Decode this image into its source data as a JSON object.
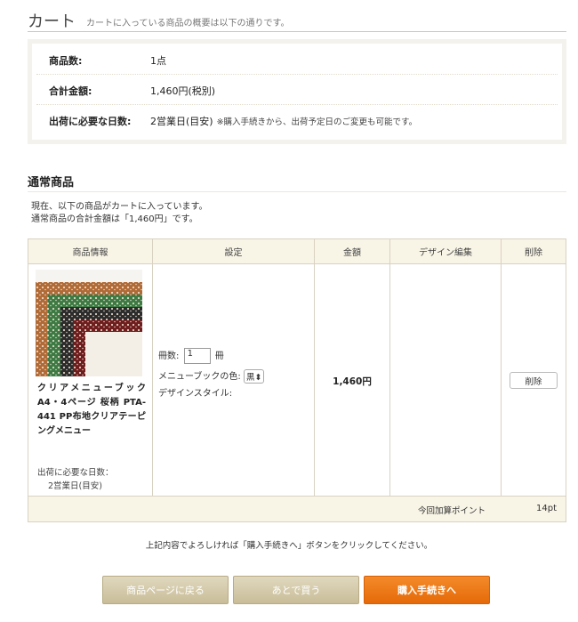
{
  "header": {
    "title": "カート",
    "subtitle": "カートに入っている商品の概要は以下の通りです。"
  },
  "summary": {
    "items_label": "商品数:",
    "items_value": "1点",
    "total_label": "合計金額:",
    "total_value": "1,460円(税別)",
    "ship_label": "出荷に必要な日数:",
    "ship_value": "2営業日(目安)",
    "ship_note": "※購入手続きから、出荷予定日のご変更も可能です。"
  },
  "section": {
    "title": "通常商品",
    "intro_line1": "現在、以下の商品がカートに入っています。",
    "intro_line2": "通常商品の合計金額は「1,460円」です。"
  },
  "table": {
    "headers": [
      "商品情報",
      "設定",
      "金額",
      "デザイン編集",
      "削除"
    ],
    "item": {
      "name": "クリアメニューブック A4・4ページ 桜柄 PTA-441 PP布地クリアテーピングメニュー",
      "ship_label": "出荷に必要な日数：",
      "ship_value": "2営業日(目安)",
      "qty_label": "冊数:",
      "qty_value": "1",
      "qty_unit": "冊",
      "color_label": "メニューブックの色:",
      "color_value": "黒",
      "style_label": "デザインスタイル:",
      "price": "1,460円",
      "delete_label": "削除"
    },
    "points_label": "今回加算ポイント",
    "points_value": "14pt"
  },
  "confirm_text": "上記内容でよろしければ「購入手続きへ」ボタンをクリックしてください。",
  "buttons": {
    "back": "商品ページに戻る",
    "later": "あとで買う",
    "buy": "購入手続きへ"
  },
  "colors": {
    "accent": "#ee7a18",
    "button_beige": "#d4c9a8",
    "header_bg": "#f8f4e6"
  }
}
